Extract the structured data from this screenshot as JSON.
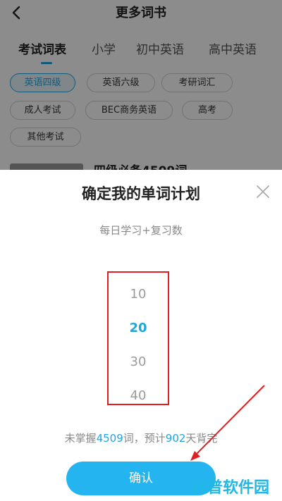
{
  "header": {
    "title": "更多词书"
  },
  "tabs": [
    {
      "label": "考试词表",
      "active": true
    },
    {
      "label": "小学"
    },
    {
      "label": "初中英语"
    },
    {
      "label": "高中英语"
    }
  ],
  "chips": [
    {
      "label": "英语四级",
      "selected": true
    },
    {
      "label": "英语六级"
    },
    {
      "label": "考研词汇"
    },
    {
      "label": "成人考试"
    },
    {
      "label": "BEC商务英语"
    },
    {
      "label": "高考"
    },
    {
      "label": "其他考试"
    }
  ],
  "book_peek": {
    "title": "四级必备4509词"
  },
  "dialog": {
    "title": "确定我的单词计划",
    "subtitle": "每日学习+复习数",
    "picker_options": [
      "10",
      "20",
      "30",
      "40"
    ],
    "selected_value": "20",
    "summary": {
      "prefix": "未掌握",
      "unmastered": "4509",
      "middle": "词，预计",
      "days": "902",
      "suffix": "天背完"
    },
    "confirm_label": "确认"
  },
  "watermark": {
    "text": "谷普软件园"
  },
  "colors": {
    "accent": "#1fa6e0",
    "button": "#24b4ef",
    "highlight_box": "#e02020",
    "annotation_arrow": "#e02020"
  }
}
